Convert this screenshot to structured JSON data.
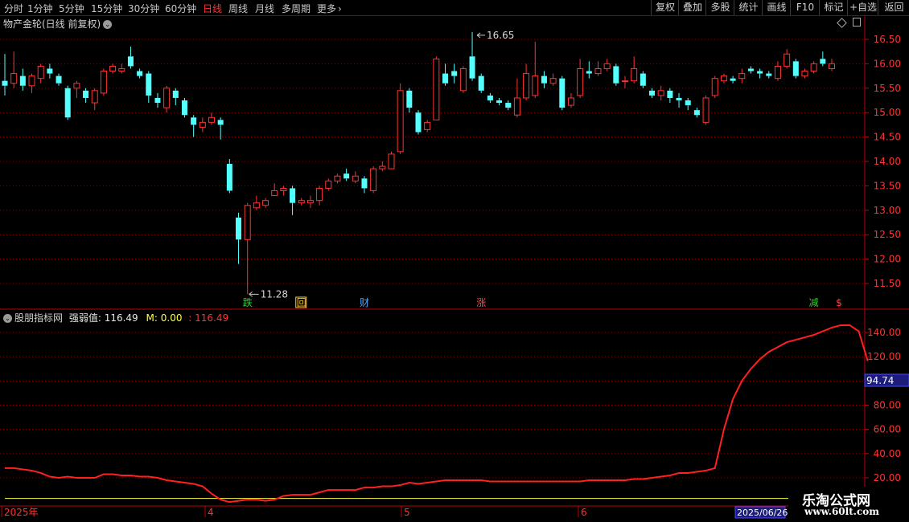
{
  "toolbar": {
    "periods": [
      "分时",
      "1分钟",
      "5分钟",
      "15分钟",
      "30分钟",
      "60分钟",
      "日线",
      "周线",
      "月线",
      "多周期",
      "更多"
    ],
    "active_period": "日线",
    "more_chevron": "›",
    "buttons": [
      "复权",
      "叠加",
      "多股",
      "统计",
      "画线",
      "F10",
      "标记",
      "+自选",
      "返回"
    ]
  },
  "main_chart": {
    "title": "物产金轮(日线 前复权)",
    "high_label": "16.65",
    "low_label": "11.28",
    "y_ticks": [
      "16.50",
      "16.00",
      "15.50",
      "15.00",
      "14.50",
      "14.00",
      "13.50",
      "13.00",
      "12.50",
      "12.00",
      "11.50"
    ],
    "markers": [
      {
        "text": "跌",
        "color": "#22dd22",
        "box": false
      },
      {
        "text": "回",
        "color": "#ffcc33",
        "box": true
      },
      {
        "text": "财",
        "color": "#4aa8ff",
        "box": false
      },
      {
        "text": "涨",
        "color": "#ff4444",
        "box": false
      },
      {
        "text": "减",
        "color": "#22dd22",
        "box": false
      },
      {
        "text": "$",
        "color": "#ff4444",
        "box": false
      }
    ]
  },
  "indicator": {
    "name": "股朋指标网",
    "label1": "强弱值: 116.49",
    "label2": "M: 0.00",
    "label3": ": 116.49",
    "y_ticks": [
      "140.00",
      "120.00",
      "100.00",
      "80.00",
      "60.00",
      "40.00",
      "20.00"
    ],
    "cursor_value": "94.74"
  },
  "x_axis": {
    "labels": [
      "2025年",
      "4",
      "5",
      "6"
    ],
    "cursor_date": "2025/06/26"
  },
  "watermark": {
    "line1": "乐淘公式网",
    "line2": "www.60lt.com"
  },
  "icons": [
    "collapse-circle-icon",
    "diamond-icon",
    "window-icon"
  ],
  "colors": {
    "up": "#ff3232",
    "down": "#54ffff",
    "line": "#ff2020",
    "m_line": "#ffff44",
    "grid": "#8b0000"
  },
  "chart_data": [
    {
      "type": "candlestick",
      "title": "物产金轮(日线 前复权)",
      "x": [
        "2025-03",
        "2025-04",
        "2025-05",
        "2025-06"
      ],
      "ylim": [
        11.1,
        16.85
      ],
      "y_ticks": [
        11.5,
        12.0,
        12.5,
        13.0,
        13.5,
        14.0,
        14.5,
        15.0,
        15.5,
        16.0,
        16.5
      ],
      "annotations": [
        {
          "text": "16.65",
          "value": 16.65
        },
        {
          "text": "11.28",
          "value": 11.28
        }
      ],
      "series": [
        {
          "values": [
            [
              15.65,
              15.55,
              16.2,
              15.35
            ],
            [
              15.6,
              15.8,
              16.25,
              15.5
            ],
            [
              15.75,
              15.55,
              15.9,
              15.45
            ],
            [
              15.55,
              15.75,
              15.8,
              15.4
            ],
            [
              15.7,
              15.95,
              16.0,
              15.6
            ],
            [
              15.9,
              15.8,
              16.0,
              15.7
            ],
            [
              15.75,
              15.6,
              15.8,
              15.55
            ],
            [
              15.5,
              14.9,
              15.55,
              14.85
            ],
            [
              15.5,
              15.6,
              15.65,
              15.3
            ],
            [
              15.45,
              15.3,
              15.5,
              15.2
            ],
            [
              15.2,
              15.45,
              15.5,
              15.05
            ],
            [
              15.4,
              15.85,
              15.9,
              15.35
            ],
            [
              15.85,
              15.95,
              16.0,
              15.8
            ],
            [
              15.85,
              15.9,
              16.0,
              15.8
            ],
            [
              16.15,
              15.95,
              16.35,
              15.9
            ],
            [
              15.85,
              15.75,
              15.9,
              15.7
            ],
            [
              15.8,
              15.35,
              15.85,
              15.2
            ],
            [
              15.3,
              15.2,
              15.4,
              15.1
            ],
            [
              15.1,
              15.5,
              15.55,
              15.0
            ],
            [
              15.45,
              15.3,
              15.5,
              15.15
            ],
            [
              15.25,
              14.95,
              15.3,
              14.9
            ],
            [
              14.9,
              14.75,
              14.95,
              14.5
            ],
            [
              14.7,
              14.8,
              14.9,
              14.6
            ],
            [
              14.8,
              14.9,
              15.0,
              14.75
            ],
            [
              14.85,
              14.75,
              14.9,
              14.45
            ],
            [
              13.95,
              13.4,
              14.05,
              13.35
            ],
            [
              12.85,
              12.4,
              12.95,
              11.9
            ],
            [
              12.4,
              13.1,
              13.15,
              11.28
            ],
            [
              13.05,
              13.15,
              13.3,
              13.0
            ],
            [
              13.1,
              13.2,
              13.25,
              13.05
            ],
            [
              13.3,
              13.4,
              13.55,
              13.3
            ],
            [
              13.4,
              13.45,
              13.5,
              13.3
            ],
            [
              13.45,
              13.15,
              13.5,
              12.9
            ],
            [
              13.15,
              13.2,
              13.25,
              13.1
            ],
            [
              13.15,
              13.2,
              13.3,
              13.05
            ],
            [
              13.2,
              13.45,
              13.5,
              13.1
            ],
            [
              13.45,
              13.6,
              13.65,
              13.4
            ],
            [
              13.6,
              13.7,
              13.75,
              13.55
            ],
            [
              13.75,
              13.65,
              13.85,
              13.6
            ],
            [
              13.6,
              13.7,
              13.8,
              13.55
            ],
            [
              13.65,
              13.45,
              13.7,
              13.35
            ],
            [
              13.4,
              13.85,
              13.9,
              13.35
            ],
            [
              13.85,
              13.9,
              14.0,
              13.8
            ],
            [
              13.85,
              14.15,
              14.2,
              13.85
            ],
            [
              14.2,
              15.45,
              15.6,
              14.15
            ],
            [
              15.45,
              15.1,
              15.5,
              15.0
            ],
            [
              15.0,
              14.6,
              15.05,
              14.55
            ],
            [
              14.65,
              14.8,
              14.85,
              14.6
            ],
            [
              14.85,
              16.1,
              16.15,
              14.85
            ],
            [
              15.8,
              15.6,
              16.0,
              15.55
            ],
            [
              15.85,
              15.75,
              16.0,
              15.6
            ],
            [
              15.45,
              15.9,
              15.95,
              15.4
            ],
            [
              16.15,
              15.7,
              16.65,
              15.65
            ],
            [
              15.75,
              15.45,
              15.8,
              15.4
            ],
            [
              15.35,
              15.25,
              15.4,
              15.2
            ],
            [
              15.25,
              15.2,
              15.3,
              15.15
            ],
            [
              15.2,
              15.1,
              15.25,
              15.05
            ],
            [
              14.95,
              15.3,
              15.7,
              14.9
            ],
            [
              15.3,
              15.8,
              16.0,
              15.25
            ],
            [
              15.35,
              15.75,
              16.45,
              15.3
            ],
            [
              15.75,
              15.6,
              15.85,
              15.5
            ],
            [
              15.6,
              15.7,
              15.8,
              15.55
            ],
            [
              15.7,
              15.1,
              15.75,
              15.05
            ],
            [
              15.15,
              15.3,
              15.4,
              15.1
            ],
            [
              15.35,
              15.9,
              16.1,
              15.3
            ],
            [
              15.85,
              15.8,
              16.05,
              15.7
            ],
            [
              15.8,
              15.9,
              16.05,
              15.75
            ],
            [
              15.9,
              16.0,
              16.1,
              15.85
            ],
            [
              15.95,
              15.6,
              16.0,
              15.55
            ],
            [
              15.65,
              15.65,
              15.75,
              15.5
            ],
            [
              15.65,
              15.9,
              16.15,
              15.6
            ],
            [
              15.8,
              15.55,
              15.85,
              15.5
            ],
            [
              15.45,
              15.35,
              15.5,
              15.3
            ],
            [
              15.35,
              15.45,
              15.55,
              15.25
            ],
            [
              15.45,
              15.3,
              15.5,
              15.2
            ],
            [
              15.3,
              15.25,
              15.4,
              15.1
            ],
            [
              15.25,
              15.15,
              15.3,
              15.05
            ],
            [
              15.05,
              14.95,
              15.1,
              14.9
            ],
            [
              14.8,
              15.3,
              15.35,
              14.75
            ],
            [
              15.35,
              15.7,
              15.75,
              15.3
            ],
            [
              15.65,
              15.75,
              15.8,
              15.6
            ],
            [
              15.7,
              15.65,
              15.75,
              15.6
            ],
            [
              15.7,
              15.8,
              15.9,
              15.6
            ],
            [
              15.9,
              15.85,
              15.95,
              15.8
            ],
            [
              15.85,
              15.8,
              15.9,
              15.7
            ],
            [
              15.8,
              15.75,
              15.85,
              15.7
            ],
            [
              15.7,
              15.95,
              16.05,
              15.65
            ],
            [
              15.95,
              16.2,
              16.3,
              15.9
            ],
            [
              16.05,
              15.75,
              16.1,
              15.7
            ],
            [
              15.75,
              15.85,
              15.9,
              15.7
            ],
            [
              15.85,
              16.0,
              16.05,
              15.8
            ],
            [
              16.1,
              16.0,
              16.25,
              15.95
            ],
            [
              15.9,
              16.0,
              16.1,
              15.85
            ]
          ]
        }
      ]
    },
    {
      "type": "line",
      "ylim": [
        10,
        152
      ],
      "y_ticks": [
        20,
        40,
        60,
        80,
        100,
        120,
        140
      ],
      "series": [
        {
          "name": "强弱值",
          "values": [
            28,
            28,
            27,
            26,
            24,
            21,
            20,
            21,
            20,
            20,
            20,
            23,
            23,
            22,
            22,
            21,
            21,
            20,
            18,
            17,
            16,
            15,
            13,
            7,
            2,
            0,
            1,
            2,
            2,
            1,
            2,
            5,
            6,
            6,
            6,
            8,
            10,
            10,
            10,
            10,
            12,
            12,
            13,
            13,
            14,
            16,
            15,
            16,
            17,
            18,
            18,
            18,
            18,
            18,
            17,
            17,
            17,
            17,
            17,
            17,
            17,
            17,
            17,
            17,
            17,
            18,
            18,
            18,
            18,
            18,
            19,
            19,
            20,
            21,
            22,
            24,
            24,
            25,
            26,
            28,
            60,
            85,
            100,
            110,
            118,
            124,
            128,
            132,
            134,
            136,
            138,
            141,
            144,
            146,
            146,
            141,
            116.49
          ]
        },
        {
          "name": "M",
          "values": [
            3,
            3,
            3,
            3,
            3,
            3,
            3,
            3,
            3,
            3,
            3,
            3,
            3,
            3,
            3,
            3,
            3,
            3,
            3,
            3,
            3,
            3,
            3,
            3,
            3,
            3,
            3,
            3,
            3,
            3,
            3,
            3,
            3,
            3,
            3,
            3,
            3,
            3,
            3,
            3,
            3,
            3,
            3,
            3,
            3,
            3,
            3,
            3,
            3,
            3,
            3,
            3,
            3,
            3,
            3,
            3,
            3,
            3,
            3,
            3,
            3,
            3,
            3,
            3,
            3,
            3,
            3,
            3,
            3,
            3,
            3,
            3,
            3,
            3,
            3,
            3,
            3,
            3,
            3,
            3,
            3,
            3,
            3,
            3,
            3,
            3,
            3,
            3,
            3,
            3,
            3,
            3,
            3,
            3,
            3,
            3,
            0.0
          ]
        }
      ]
    }
  ]
}
